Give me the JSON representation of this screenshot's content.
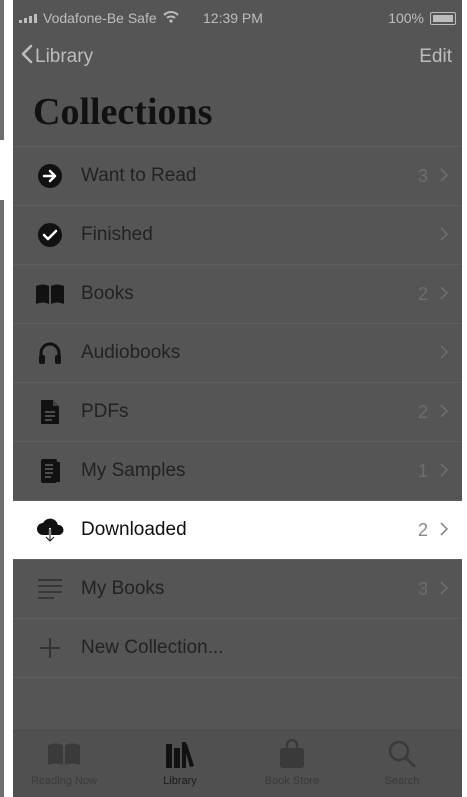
{
  "status": {
    "carrier": "Vodafone-Be Safe",
    "time": "12:39 PM",
    "battery": "100%"
  },
  "nav": {
    "back_label": "Library",
    "edit_label": "Edit"
  },
  "title": "Collections",
  "list": [
    {
      "label": "Want to Read",
      "count": "3",
      "icon": "arrow-right-circle-icon"
    },
    {
      "label": "Finished",
      "count": "",
      "icon": "check-circle-icon"
    },
    {
      "label": "Books",
      "count": "2",
      "icon": "book-open-icon"
    },
    {
      "label": "Audiobooks",
      "count": "",
      "icon": "headphones-icon"
    },
    {
      "label": "PDFs",
      "count": "2",
      "icon": "document-icon"
    },
    {
      "label": "My Samples",
      "count": "1",
      "icon": "sample-document-icon"
    },
    {
      "label": "Downloaded",
      "count": "2",
      "icon": "cloud-download-icon"
    },
    {
      "label": "My Books",
      "count": "3",
      "icon": "list-lines-icon"
    },
    {
      "label": "New Collection...",
      "count": "",
      "icon": "plus-icon"
    }
  ],
  "tabbar": [
    {
      "label": "Reading Now",
      "icon": "book-open-icon"
    },
    {
      "label": "Library",
      "icon": "library-icon"
    },
    {
      "label": "Book Store",
      "icon": "bag-icon"
    },
    {
      "label": "Search",
      "icon": "search-icon"
    }
  ],
  "colors": {
    "overlay": "#555555",
    "highlight": "#ffffff",
    "text_dark": "#222222"
  }
}
